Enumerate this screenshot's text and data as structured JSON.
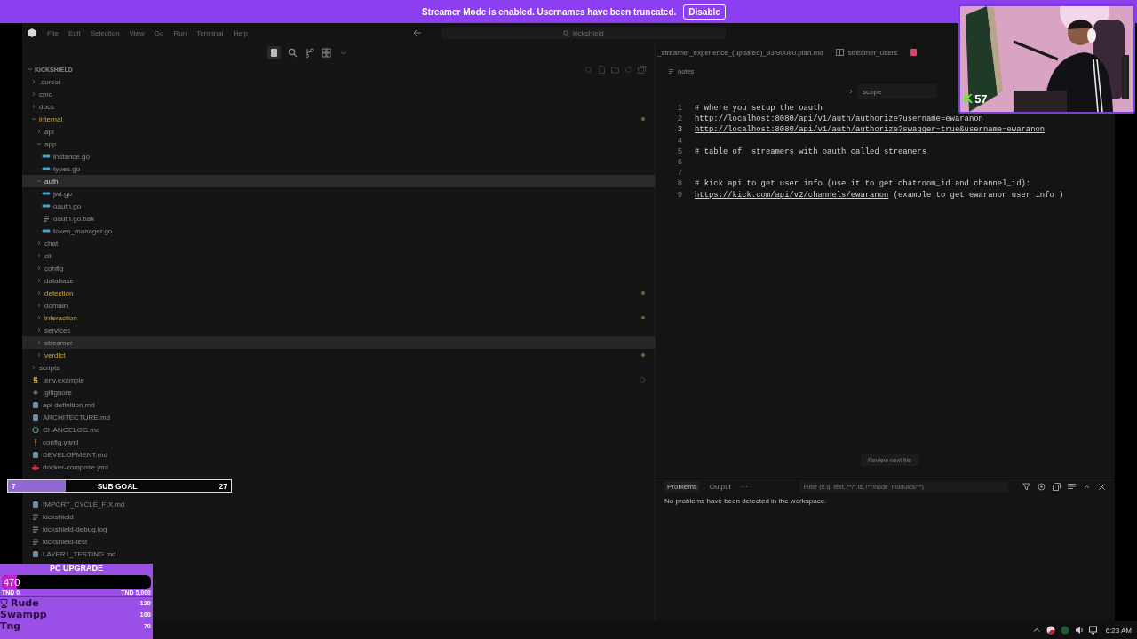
{
  "banner": {
    "message": "Streamer Mode is enabled. Usernames have been truncated.",
    "button": "Disable"
  },
  "menu": [
    "File",
    "Edit",
    "Selection",
    "View",
    "Go",
    "Run",
    "Terminal",
    "Help"
  ],
  "search": {
    "value": "kickshield"
  },
  "explorer": {
    "title": "KICKSHIELD",
    "tree": [
      {
        "name": ".cursor",
        "kind": "folder",
        "expanded": false,
        "selected": false
      },
      {
        "name": "cmd",
        "kind": "folder",
        "expanded": false,
        "selected": false
      },
      {
        "name": "docs",
        "kind": "folder",
        "expanded": false,
        "selected": false
      },
      {
        "name": "internal",
        "kind": "folder",
        "expanded": true,
        "selected": false,
        "modified": true,
        "children": [
          {
            "name": "api",
            "kind": "folder",
            "expanded": false,
            "selected": false
          },
          {
            "name": "app",
            "kind": "folder",
            "expanded": true,
            "selected": false,
            "children": [
              {
                "name": "instance.go",
                "kind": "go",
                "selected": false
              },
              {
                "name": "types.go",
                "kind": "go",
                "selected": false
              }
            ]
          },
          {
            "name": "auth",
            "kind": "folder",
            "expanded": true,
            "selected": true,
            "children": [
              {
                "name": "jwt.go",
                "kind": "go",
                "selected": false
              },
              {
                "name": "oauth.go",
                "kind": "go",
                "selected": false
              },
              {
                "name": "oauth.go.bak",
                "kind": "file",
                "selected": false
              },
              {
                "name": "token_manager.go",
                "kind": "go",
                "selected": false
              }
            ]
          },
          {
            "name": "chat",
            "kind": "folder",
            "expanded": false,
            "selected": false
          },
          {
            "name": "cli",
            "kind": "folder",
            "expanded": false,
            "selected": false
          },
          {
            "name": "config",
            "kind": "folder",
            "expanded": false,
            "selected": false
          },
          {
            "name": "database",
            "kind": "folder",
            "expanded": false,
            "selected": false
          },
          {
            "name": "detection",
            "kind": "folder",
            "expanded": false,
            "selected": false,
            "modified": true
          },
          {
            "name": "domain",
            "kind": "folder",
            "expanded": false,
            "selected": false
          },
          {
            "name": "interaction",
            "kind": "folder",
            "expanded": false,
            "selected": false,
            "modified": true
          },
          {
            "name": "services",
            "kind": "folder",
            "expanded": false,
            "selected": false
          },
          {
            "name": "streamer",
            "kind": "folder",
            "expanded": false,
            "selected": false,
            "hovered": true
          },
          {
            "name": "verdict",
            "kind": "folder",
            "expanded": false,
            "selected": false,
            "modified": true
          }
        ]
      },
      {
        "name": "scripts",
        "kind": "folder",
        "expanded": false,
        "selected": false
      },
      {
        "name": ".env.example",
        "kind": "env",
        "selected": false,
        "ignored": true
      },
      {
        "name": ".gitignore",
        "kind": "git",
        "selected": false
      },
      {
        "name": "api-definition.md",
        "kind": "md",
        "selected": false
      },
      {
        "name": "ARCHITECTURE.md",
        "kind": "md",
        "selected": false
      },
      {
        "name": "CHANGELOG.md",
        "kind": "changelog",
        "selected": false
      },
      {
        "name": "config.yaml",
        "kind": "yaml",
        "selected": false
      },
      {
        "name": "DEVELOPMENT.md",
        "kind": "md",
        "selected": false
      },
      {
        "name": "docker-compose.yml",
        "kind": "docker",
        "selected": false
      }
    ],
    "tree_lower": [
      {
        "name": "IMPORT_CYCLE_FIX.md",
        "kind": "md",
        "selected": false
      },
      {
        "name": "kickshield",
        "kind": "file",
        "selected": false
      },
      {
        "name": "kickshield-debug.log",
        "kind": "file",
        "selected": false
      },
      {
        "name": "kickshield-test",
        "kind": "file",
        "selected": false
      },
      {
        "name": "LAYER1_TESTING.md",
        "kind": "md",
        "selected": false
      }
    ]
  },
  "editor": {
    "tabs": [
      {
        "label": "_streamer_experience_(updated)_93f90080.plan.md",
        "kind": "markdown"
      },
      {
        "label": "streamer_users",
        "kind": "table"
      },
      {
        "kind": "database"
      }
    ],
    "breadcrumb": "notes",
    "find": {
      "value": "scope"
    },
    "lines": [
      {
        "number": "1",
        "current": false,
        "segments": [
          {
            "kind": "comment",
            "text": "# where you setup the oauth"
          }
        ]
      },
      {
        "number": "2",
        "current": false,
        "segments": [
          {
            "kind": "link",
            "text": "http://localhost:8080/api/v1/auth/authorize?username=ewaranon"
          }
        ]
      },
      {
        "number": "3",
        "current": true,
        "segments": [
          {
            "kind": "link",
            "text": "http://localhost:8080/api/v1/auth/authorize?swagger=true&username=ewaranon"
          }
        ]
      },
      {
        "number": "4",
        "current": false
      },
      {
        "number": "5",
        "current": false,
        "segments": [
          {
            "kind": "comment",
            "text": "# table of  streamers with oauth called streamers"
          }
        ]
      },
      {
        "number": "6",
        "current": false
      },
      {
        "number": "7",
        "current": false
      },
      {
        "number": "8",
        "current": false,
        "segments": [
          {
            "kind": "comment",
            "text": "# kick api to get user info (use it to get chatroom_id and channel_id):"
          }
        ]
      },
      {
        "number": "9",
        "current": false,
        "segments": [
          {
            "kind": "link",
            "text": "https://kick.com/api/v2/channels/ewaranon"
          },
          {
            "kind": "plain",
            "text": " (example to get ewaranon user info )"
          }
        ]
      }
    ],
    "review_button": "Review next file"
  },
  "panel": {
    "tabs": [
      {
        "label": "Problems",
        "selected": true
      },
      {
        "label": "Output",
        "selected": false
      }
    ],
    "more": "···",
    "filter": {
      "placeholder": "Filter (e.g. text, **/*.ts, !**/node_modules/**)"
    },
    "message": "No problems have been detected in the workspace."
  },
  "webcam": {
    "logo": "K",
    "count": "57"
  },
  "sub_goal": {
    "current": "7",
    "label": "SUB GOAL",
    "target": "27",
    "level": 0.26
  },
  "donation_goal": {
    "title": "PC UPGRADE",
    "amount": "470",
    "level": 0.1,
    "min": "TND 0",
    "max": "TND 5,000",
    "leaders": [
      {
        "name": "Rude",
        "amount": "120",
        "top": true
      },
      {
        "name": "Swampp",
        "amount": "100",
        "top": false
      },
      {
        "name": "Tng",
        "amount": "70",
        "top": false
      }
    ]
  },
  "taskbar": {
    "time": "6:23 AM"
  }
}
